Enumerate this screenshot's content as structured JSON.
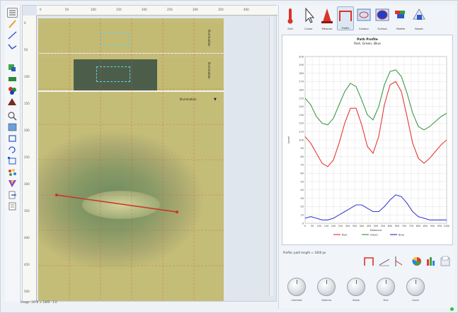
{
  "canvas": {
    "strip1_label": "Illumination",
    "strip2_label": "Illumination",
    "strip3_label": "Illumination",
    "status": "Image: 1076 × 1440 · 1.0"
  },
  "ruler": {
    "top_ticks": [
      "0",
      "50",
      "100",
      "150",
      "200",
      "250",
      "300",
      "350",
      "400"
    ],
    "left_ticks": [
      "0",
      "50",
      "100",
      "150",
      "200",
      "250",
      "300",
      "350",
      "400",
      "450",
      "500"
    ]
  },
  "tools": {
    "items": [
      {
        "label": "Grid",
        "icon": "thermometer-icon"
      },
      {
        "label": "Cursor",
        "icon": "cursor-icon"
      },
      {
        "label": "Measure",
        "icon": "cone-icon"
      },
      {
        "label": "Profile",
        "icon": "profile-icon"
      },
      {
        "label": "Contour",
        "icon": "contour-icon"
      },
      {
        "label": "Surface",
        "icon": "surface-icon"
      },
      {
        "label": "Palette",
        "icon": "palette-icon"
      },
      {
        "label": "Report",
        "icon": "report-icon"
      }
    ]
  },
  "chart": {
    "title": "Path Profile",
    "subtitle": "Red, Green, Blue"
  },
  "info": {
    "line": "Profile: path length ≈ 1000 px"
  },
  "knobs": [
    {
      "label": "Contrast"
    },
    {
      "label": "Gamma"
    },
    {
      "label": "Zoom"
    },
    {
      "label": "Hue"
    },
    {
      "label": "Level"
    }
  ],
  "colors": {
    "red": "#e53935",
    "green": "#3c9a4a",
    "blue": "#3a3ad6",
    "image_base": "#c4bd78",
    "accent": "#2f6fdb"
  },
  "chart_data": {
    "type": "line",
    "x": [
      0,
      40,
      80,
      120,
      160,
      200,
      240,
      280,
      320,
      360,
      400,
      440,
      480,
      520,
      560,
      600,
      640,
      680,
      720,
      760,
      800,
      840,
      880,
      920,
      960,
      1000
    ],
    "series": [
      {
        "name": "Green",
        "values": [
          150,
          142,
          128,
          120,
          118,
          126,
          142,
          158,
          168,
          164,
          148,
          130,
          124,
          140,
          166,
          182,
          184,
          176,
          156,
          132,
          116,
          112,
          116,
          122,
          128,
          132
        ]
      },
      {
        "name": "Red",
        "values": [
          104,
          96,
          84,
          72,
          68,
          76,
          96,
          120,
          138,
          138,
          118,
          92,
          84,
          104,
          142,
          166,
          170,
          158,
          128,
          96,
          78,
          72,
          78,
          86,
          94,
          100
        ]
      },
      {
        "name": "Blue",
        "values": [
          6,
          8,
          6,
          4,
          4,
          6,
          10,
          14,
          18,
          22,
          22,
          18,
          14,
          14,
          20,
          28,
          34,
          32,
          24,
          14,
          8,
          6,
          4,
          4,
          4,
          4
        ]
      }
    ],
    "ylim": [
      0,
      200
    ],
    "xlim": [
      0,
      1000
    ],
    "y_ticks": [
      "200",
      "190",
      "180",
      "170",
      "160",
      "150",
      "140",
      "130",
      "120",
      "110",
      "100",
      "90",
      "80",
      "70",
      "60",
      "50",
      "40",
      "30",
      "20",
      "10",
      "0"
    ],
    "x_ticks": [
      "0",
      "50",
      "100",
      "150",
      "200",
      "250",
      "300",
      "350",
      "400",
      "450",
      "500",
      "550",
      "600",
      "650",
      "700",
      "750",
      "800",
      "850",
      "900",
      "950",
      "1000"
    ],
    "xlabel": "Distance",
    "ylabel": "Level",
    "legend": [
      "Red",
      "Green",
      "Blue"
    ],
    "legend_position": "bottom",
    "grid": true
  }
}
